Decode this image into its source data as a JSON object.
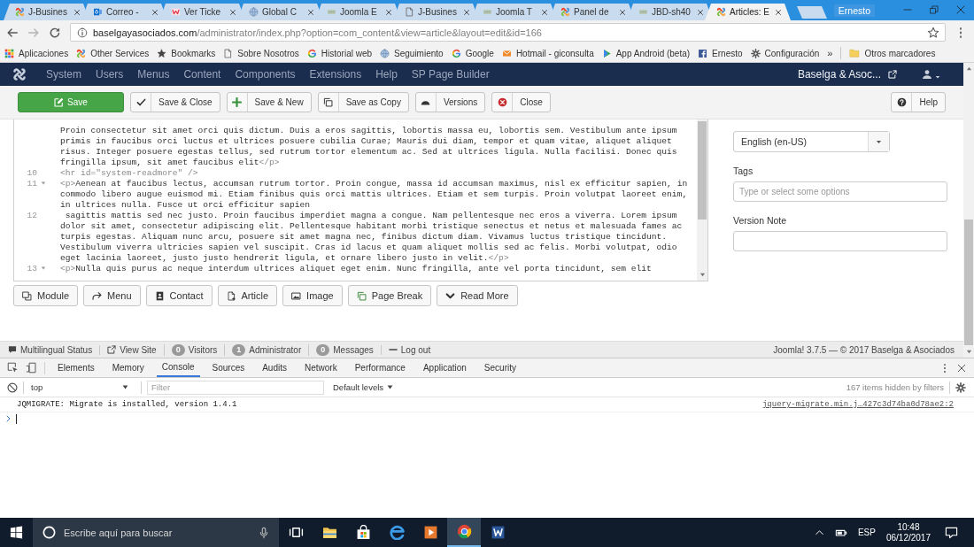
{
  "browser": {
    "tabs": [
      {
        "label": "J-Busines",
        "kind": "joomla",
        "selected": false
      },
      {
        "label": "Correo -",
        "kind": "outlook",
        "selected": false
      },
      {
        "label": "Ver Ticke",
        "kind": "ticket",
        "selected": false
      },
      {
        "label": "Global C",
        "kind": "globe",
        "selected": false
      },
      {
        "label": "Joomla E",
        "kind": "jbd",
        "selected": false
      },
      {
        "label": "J-Busines",
        "kind": "page",
        "selected": false
      },
      {
        "label": "Joomla T",
        "kind": "jbd",
        "selected": false
      },
      {
        "label": "Panel de",
        "kind": "joomla",
        "selected": false
      },
      {
        "label": "JBD-sh40",
        "kind": "jbd",
        "selected": false
      },
      {
        "label": "Articles: E",
        "kind": "joomla",
        "selected": true
      }
    ],
    "profile": "Ernesto",
    "address": {
      "host": "baselgayasociados.com",
      "path": "/administrator/index.php?option=com_content&view=article&layout=edit&id=166"
    },
    "bookmarks": [
      {
        "label": "Aplicaciones",
        "kind": "apps"
      },
      {
        "label": "Other Services",
        "kind": "joomla"
      },
      {
        "label": "Bookmarks",
        "kind": "star"
      },
      {
        "label": "Sobre Nosotros",
        "kind": "page"
      },
      {
        "label": "Historial web",
        "kind": "google"
      },
      {
        "label": "Seguimiento",
        "kind": "globe"
      },
      {
        "label": "Google",
        "kind": "google"
      },
      {
        "label": "Hotmail - giconsulta",
        "kind": "hotmail"
      },
      {
        "label": "App Android (beta)",
        "kind": "play"
      },
      {
        "label": "Ernesto",
        "kind": "facebook"
      },
      {
        "label": "Configuración",
        "kind": "gear"
      }
    ],
    "bookmarks_more": "»",
    "other_bookmarks": "Otros marcadores"
  },
  "admin": {
    "menu": [
      "System",
      "Users",
      "Menus",
      "Content",
      "Components",
      "Extensions",
      "Help",
      "SP Page Builder"
    ],
    "site": "Baselga & Asoc...",
    "toolbar": [
      {
        "label": "Save",
        "kind": "save"
      },
      {
        "label": "Save & Close",
        "kind": "save-close"
      },
      {
        "label": "Save & New",
        "kind": "save-new"
      },
      {
        "label": "Save as Copy",
        "kind": "save-copy"
      },
      {
        "label": "Versions",
        "kind": "versions"
      },
      {
        "label": "Close",
        "kind": "close"
      }
    ],
    "help": "Help"
  },
  "editor": {
    "rows": [
      {
        "parts": [
          {
            "kind": "text",
            "text": "Proin consectetur sit amet orci quis dictum. Duis a eros sagittis, lobortis massa eu, lobortis sem. Vestibulum ante ipsum"
          }
        ]
      },
      {
        "parts": [
          {
            "kind": "text",
            "text": "primis in faucibus orci luctus et ultrices posuere cubilia Curae; Mauris dui diam, tempor et quam vitae, aliquet aliquet"
          }
        ]
      },
      {
        "parts": [
          {
            "kind": "text",
            "text": "risus. Integer posuere egestas tellus, sed rutrum tortor elementum ac. Sed at ultrices ligula. Nulla facilisi. Donec quis"
          }
        ]
      },
      {
        "parts": [
          {
            "kind": "text",
            "text": "fringilla ipsum, sit amet faucibus elit"
          },
          {
            "kind": "tag",
            "text": "</p>"
          }
        ]
      },
      {
        "number": "10",
        "foldable": false,
        "parts": [
          {
            "kind": "tag",
            "text": "<hr id=\"system-readmore\" />"
          }
        ]
      },
      {
        "number": "11",
        "foldable": true,
        "parts": [
          {
            "kind": "tag",
            "text": "<p>"
          },
          {
            "kind": "text",
            "text": "Aenean at faucibus lectus, accumsan rutrum tortor. Proin congue, massa id accumsan maximus, nisl ex efficitur sapien, in"
          }
        ]
      },
      {
        "parts": [
          {
            "kind": "text",
            "text": "commodo libero augue euismod mi. Etiam finibus quis orci mattis ultrices. Etiam et sem turpis. Proin volutpat laoreet enim,"
          }
        ]
      },
      {
        "parts": [
          {
            "kind": "text",
            "text": "in ultrices nulla. Fusce ut orci efficitur sapien"
          }
        ]
      },
      {
        "number": "12",
        "foldable": false,
        "parts": [
          {
            "kind": "text",
            "text": " sagittis mattis sed nec justo. Proin faucibus imperdiet magna a congue. Nam pellentesque nec eros a viverra. Lorem ipsum"
          }
        ]
      },
      {
        "parts": [
          {
            "kind": "text",
            "text": "dolor sit amet, consectetur adipiscing elit. Pellentesque habitant morbi tristique senectus et netus et malesuada fames ac"
          }
        ]
      },
      {
        "parts": [
          {
            "kind": "text",
            "text": "turpis egestas. Aliquam nunc arcu, posuere sit amet magna nec, finibus dictum diam. Vivamus luctus tristique tincidunt."
          }
        ]
      },
      {
        "parts": [
          {
            "kind": "text",
            "text": "Vestibulum viverra ultricies sapien vel suscipit. Cras id lacus et quam aliquet mollis sed ac felis. Morbi volutpat, odio"
          }
        ]
      },
      {
        "parts": [
          {
            "kind": "text",
            "text": "eget lacinia laoreet, justo justo hendrerit ligula, et ornare libero justo in velit."
          },
          {
            "kind": "tag",
            "text": "</p>"
          }
        ]
      },
      {
        "number": "13",
        "foldable": true,
        "parts": [
          {
            "kind": "tag",
            "text": "<p>"
          },
          {
            "kind": "text",
            "text": "Nulla quis purus ac neque interdum ultrices aliquet eget enim. Nunc fringilla, ante vel porta tincidunt, sem elit"
          }
        ]
      }
    ]
  },
  "editor_buttons": [
    {
      "label": "Module",
      "kind": "module"
    },
    {
      "label": "Menu",
      "kind": "menu"
    },
    {
      "label": "Contact",
      "kind": "contact"
    },
    {
      "label": "Article",
      "kind": "article"
    },
    {
      "label": "Image",
      "kind": "image"
    },
    {
      "label": "Page Break",
      "kind": "page-break"
    },
    {
      "label": "Read More",
      "kind": "read-more"
    }
  ],
  "options": {
    "language": "English (en-US)",
    "tags_label": "Tags",
    "tags_placeholder": "Type or select some options",
    "note_label": "Version Note"
  },
  "status_bar": {
    "items": [
      {
        "kind": "multilingual",
        "label": "Multilingual Status"
      },
      {
        "kind": "site",
        "label": "View Site"
      },
      {
        "kind": "count",
        "count": "0",
        "label": "Visitors"
      },
      {
        "kind": "count",
        "count": "1",
        "label": "Administrator"
      },
      {
        "kind": "count",
        "count": "0",
        "label": "Messages"
      },
      {
        "kind": "logout",
        "label": "Log out"
      }
    ],
    "footer": "Joomla! 3.7.5 — © 2017 Baselga & Asociados"
  },
  "devtools": {
    "tabs": [
      {
        "label": "Elements",
        "selected": false
      },
      {
        "label": "Memory",
        "selected": false
      },
      {
        "label": "Console",
        "selected": true
      },
      {
        "label": "Sources",
        "selected": false
      },
      {
        "label": "Audits",
        "selected": false
      },
      {
        "label": "Network",
        "selected": false
      },
      {
        "label": "Performance",
        "selected": false
      },
      {
        "label": "Application",
        "selected": false
      },
      {
        "label": "Security",
        "selected": false
      }
    ],
    "context": "top",
    "filter_placeholder": "Filter",
    "levels": "Default levels",
    "hidden": "167 items hidden by filters",
    "messages": [
      {
        "text": "JQMIGRATE: Migrate is installed, version 1.4.1",
        "source": "jquery-migrate.min.j…427c3d74ba0d78ae2:2"
      }
    ]
  },
  "taskbar": {
    "search_placeholder": "Escribe aquí para buscar",
    "apps": [
      {
        "kind": "task-view",
        "selected": false
      },
      {
        "kind": "explorer",
        "selected": false
      },
      {
        "kind": "store",
        "selected": false
      },
      {
        "kind": "edge",
        "selected": false
      },
      {
        "kind": "media",
        "selected": false
      },
      {
        "kind": "chrome",
        "selected": true
      },
      {
        "kind": "word",
        "selected": false
      }
    ],
    "language": "ESP",
    "time": "10:48",
    "date": "06/12/2017"
  }
}
